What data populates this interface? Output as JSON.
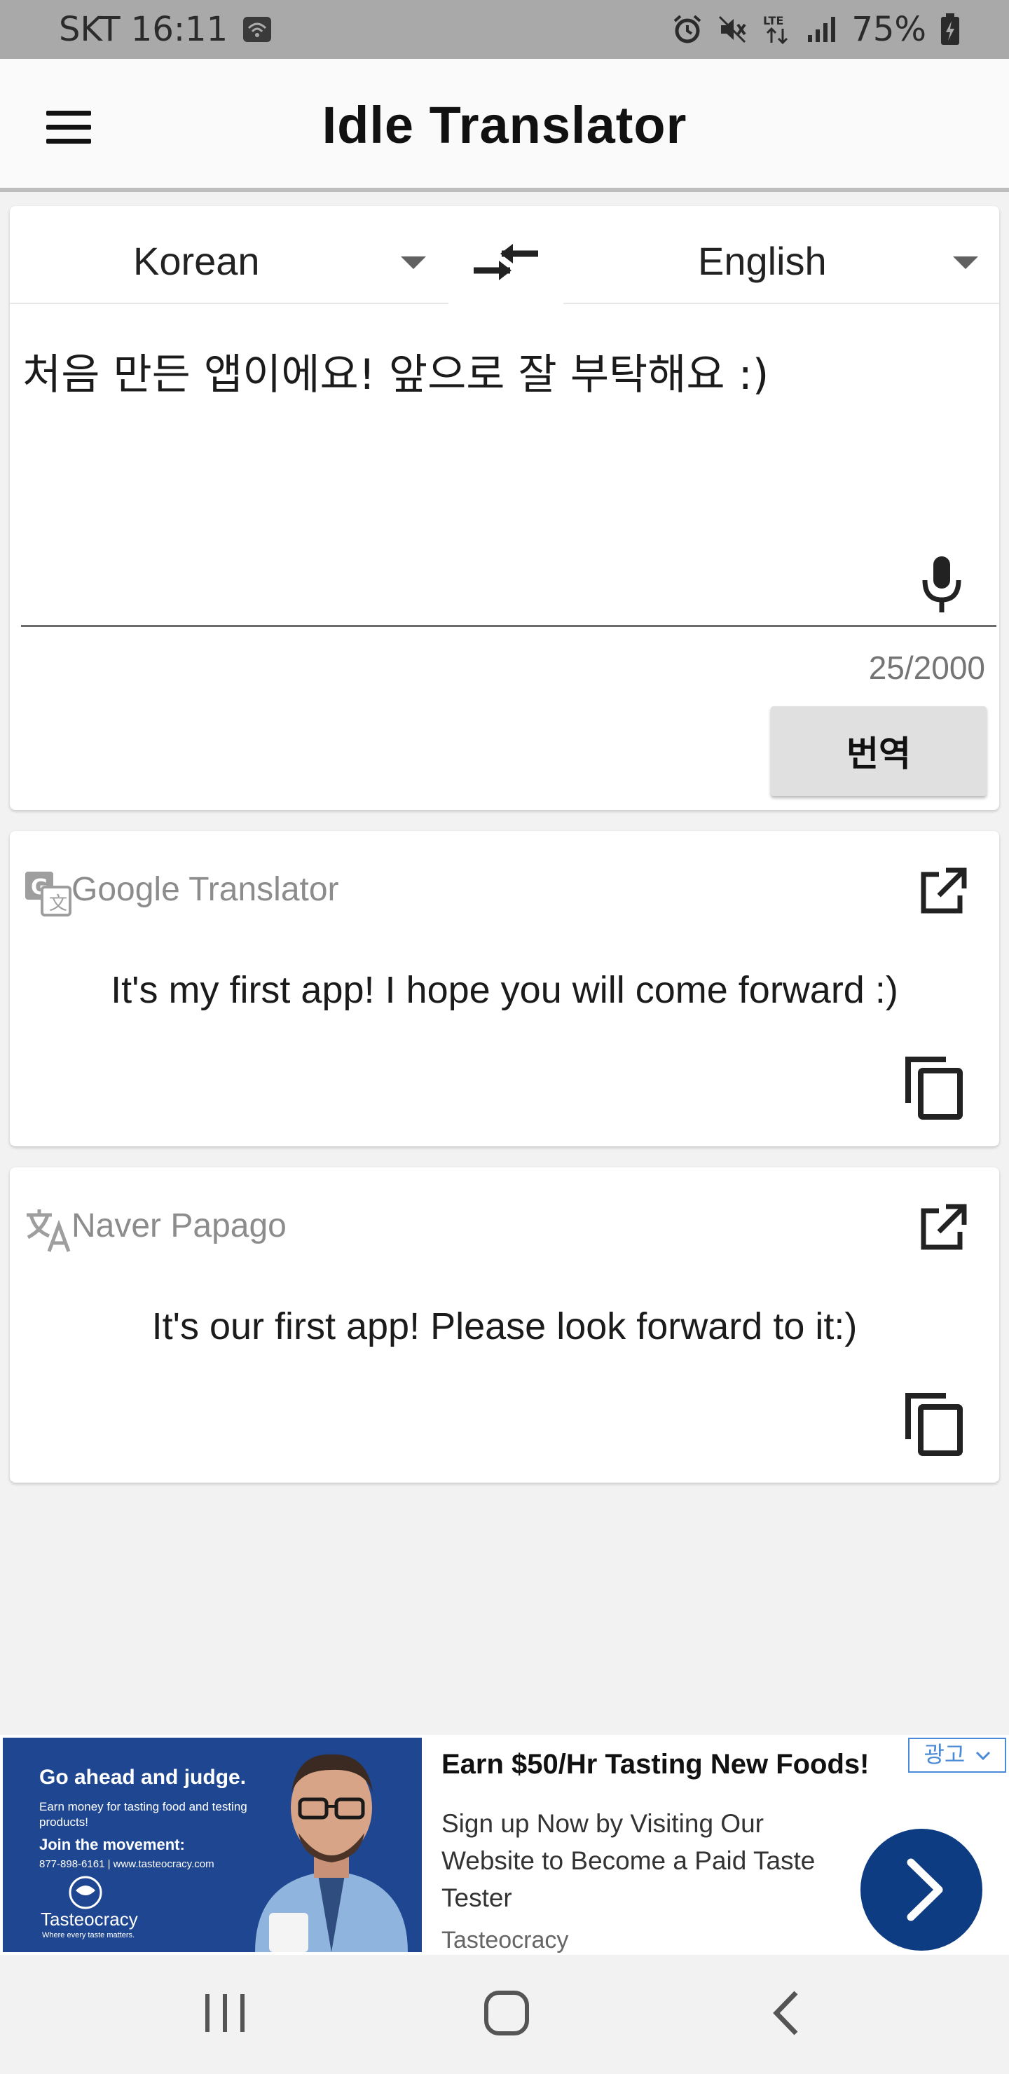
{
  "status_bar": {
    "carrier_time": "SKT 16:11",
    "battery": "75%",
    "network": "LTE"
  },
  "app_bar": {
    "title": "Idle Translator"
  },
  "input_card": {
    "source_language": "Korean",
    "target_language": "English",
    "source_text": "처음 만든 앱이에요! 앞으로 잘 부탁해요 :)",
    "char_counter": "25/2000",
    "translate_label": "번역"
  },
  "results": [
    {
      "engine": "Google Translator",
      "text": "It's my first app! I hope you will come forward :)"
    },
    {
      "engine": "Naver Papago",
      "text": "It's our first app! Please look forward to it:)"
    }
  ],
  "ad": {
    "image_headline": "Go ahead and judge.",
    "image_sub": "Earn money for tasting food and testing products!",
    "image_join": "Join the movement:",
    "image_contact": "877-898-6161  |  www.tasteocracy.com",
    "image_brand": "Tasteocracy",
    "image_tagline": "Where every taste matters.",
    "title": "Earn $50/Hr Tasting New Foods!",
    "badge": "광고",
    "body": "Sign up Now by Visiting Our Website to Become a Paid Taste Tester",
    "advertiser": "Tasteocracy"
  },
  "colors": {
    "status_bar_bg": "#a9a9a9",
    "page_bg": "#f2f2f2",
    "ad_image_bg": "#1f4690",
    "ad_cta": "#0d3c82",
    "ad_badge": "#4a8ad6"
  }
}
